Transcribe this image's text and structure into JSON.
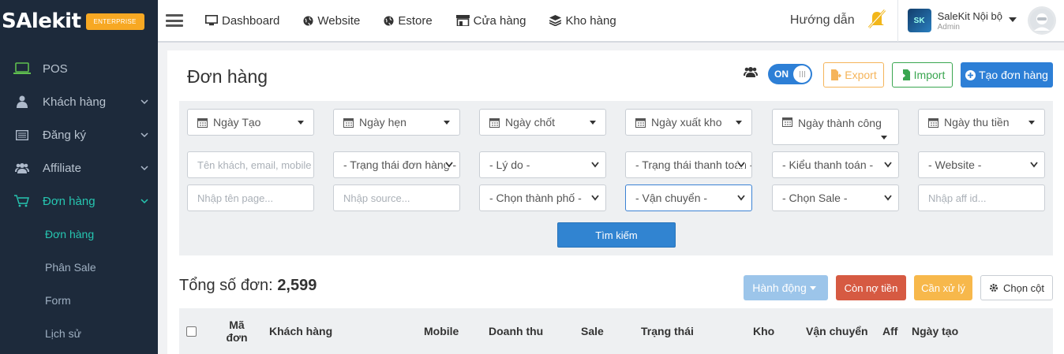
{
  "brand": {
    "logo": "SAlekit",
    "edition": "ENTERPRISE"
  },
  "sidebar": {
    "items": [
      {
        "label": "POS",
        "icon": "laptop-icon"
      },
      {
        "label": "Khách hàng",
        "icon": "user-icon"
      },
      {
        "label": "Đăng ký",
        "icon": "list-icon"
      },
      {
        "label": "Affiliate",
        "icon": "users-icon"
      },
      {
        "label": "Đơn hàng",
        "icon": "cart-icon"
      }
    ],
    "subitems": [
      "Đơn hàng",
      "Phân Sale",
      "Form",
      "Lịch sử"
    ]
  },
  "topbar": {
    "nav": [
      "Dashboard",
      "Website",
      "Estore",
      "Cửa hàng",
      "Kho hàng"
    ],
    "guide": "Hướng dẫn",
    "user_name": "SaleKit Nội bộ",
    "user_role": "Admin"
  },
  "page": {
    "title": "Đơn hàng",
    "toggle": "ON",
    "export_label": "Export",
    "import_label": "Import",
    "create_label": "Tạo đơn hàng"
  },
  "filters": {
    "dates": [
      "Ngày Tạo",
      "Ngày hẹn",
      "Ngày chốt",
      "Ngày xuất kho",
      "Ngày thành công",
      "Ngày thu tiền"
    ],
    "customer_placeholder": "Tên khách, email, mobile",
    "order_status": "- Trạng thái đơn hàng -",
    "reason": "- Lý do -",
    "payment_status": "- Trạng thái thanh toán -",
    "payment_type": "- Kiểu thanh toán -",
    "website": "- Website -",
    "page_placeholder": "Nhập tên page...",
    "source_placeholder": "Nhập source...",
    "city": "- Chọn thành phố -",
    "shipping": "- Vận chuyển -",
    "sale": "- Chọn Sale -",
    "aff_placeholder": "Nhập aff id...",
    "search_label": "Tìm kiếm"
  },
  "summary": {
    "total_label": "Tổng số đơn:",
    "total_value": "2,599",
    "action_label": "Hành động",
    "debt_label": "Còn nợ tiền",
    "process_label": "Cần xử lý",
    "columns_label": "Chọn cột"
  },
  "table": {
    "headers": [
      "Mã đơn",
      "Khách hàng",
      "Mobile",
      "Doanh thu",
      "Sale",
      "Trạng thái",
      "Kho",
      "Vận chuyển",
      "Aff",
      "Ngày tạo"
    ]
  },
  "colors": {
    "sidebar_bg": "#1d2a3b",
    "accent": "#26c6b1",
    "primary": "#2d7fd6",
    "warning": "#f7b84b",
    "danger": "#d65a42",
    "success": "#3aa650"
  }
}
